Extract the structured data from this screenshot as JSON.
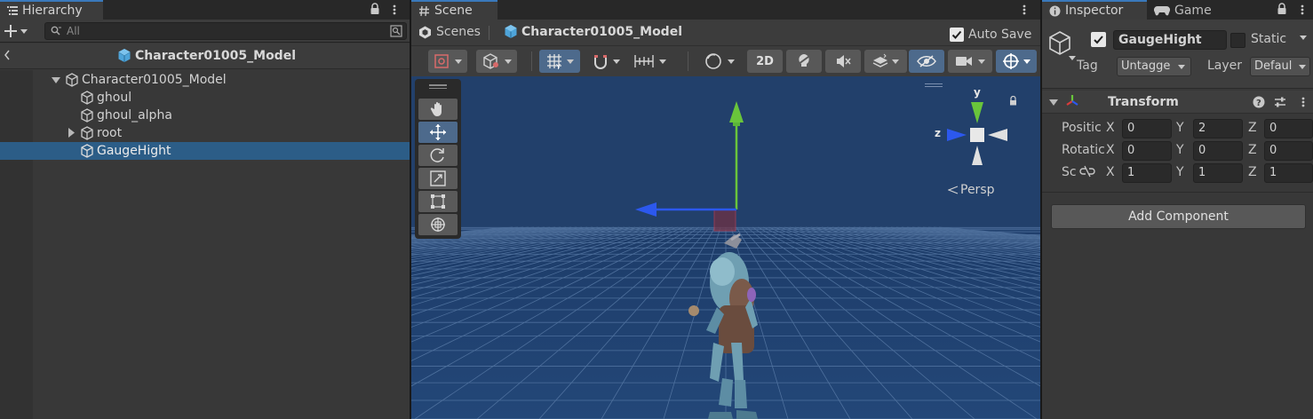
{
  "hierarchy": {
    "tab_label": "Hierarchy",
    "search_placeholder": "All",
    "breadcrumb": "Character01005_Model",
    "tree": [
      {
        "label": "Character01005_Model",
        "depth": 0,
        "expanded": true,
        "selected": false
      },
      {
        "label": "ghoul",
        "depth": 1,
        "selected": false
      },
      {
        "label": "ghoul_alpha",
        "depth": 1,
        "selected": false
      },
      {
        "label": "root",
        "depth": 1,
        "collapsed": true,
        "selected": false
      },
      {
        "label": "GaugeHight",
        "depth": 1,
        "selected": true
      }
    ]
  },
  "scene": {
    "tab_label": "Scene",
    "breadcrumb_root": "Scenes",
    "breadcrumb_current": "Character01005_Model",
    "auto_save_label": "Auto Save",
    "auto_save_checked": true,
    "mode_2d_label": "2D",
    "projection_label": "Persp",
    "gizmo_axes": {
      "y": "y",
      "z": "z"
    },
    "tools": [
      "hand-tool",
      "move-tool",
      "rotate-tool",
      "scale-tool",
      "rect-tool",
      "transform-tool"
    ],
    "active_tool": "move-tool"
  },
  "inspector": {
    "tab_label": "Inspector",
    "game_tab_label": "Game",
    "object_name": "GaugeHight",
    "active_checked": true,
    "static_label": "Static",
    "tag_label": "Tag",
    "tag_value": "Untagge",
    "layer_label": "Layer",
    "layer_value": "Defaul",
    "transform_title": "Transform",
    "position_label": "Positic",
    "rotation_label": "Rotatic",
    "scale_label": "Sc",
    "position": {
      "x": "0",
      "y": "2",
      "z": "0"
    },
    "rotation": {
      "x": "0",
      "y": "0",
      "z": "0"
    },
    "scale": {
      "x": "1",
      "y": "1",
      "z": "1"
    },
    "axis_x": "X",
    "axis_y": "Y",
    "axis_z": "Z",
    "add_component_label": "Add Component"
  },
  "colors": {
    "selection": "#2c5d87",
    "accent": "#3a79bb",
    "viewport_sky": "#22406b",
    "x_axis": "#db3b3b",
    "y_axis": "#69c53b",
    "z_axis": "#2c58ee"
  }
}
